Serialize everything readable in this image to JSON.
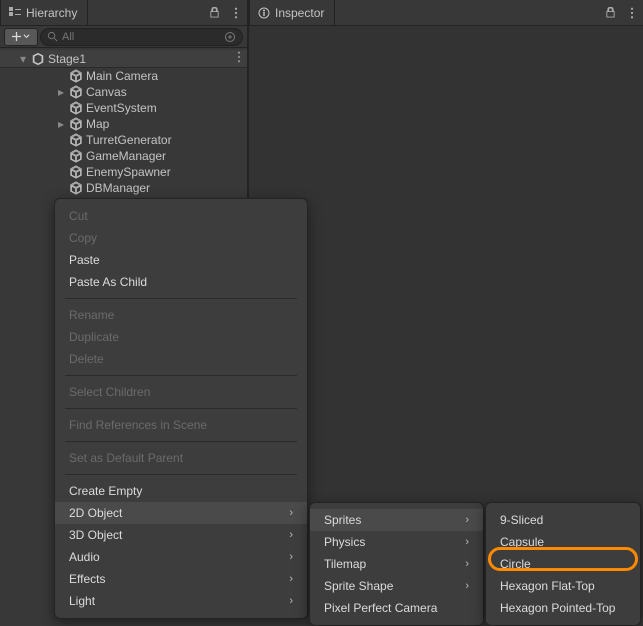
{
  "panels": {
    "hierarchy": {
      "title": "Hierarchy"
    },
    "inspector": {
      "title": "Inspector"
    }
  },
  "toolbar": {
    "search_placeholder": "All"
  },
  "scene": {
    "name": "Stage1",
    "items": [
      {
        "label": "Main Camera",
        "children": false
      },
      {
        "label": "Canvas",
        "children": true
      },
      {
        "label": "EventSystem",
        "children": false
      },
      {
        "label": "Map",
        "children": true
      },
      {
        "label": "TurretGenerator",
        "children": false
      },
      {
        "label": "GameManager",
        "children": false
      },
      {
        "label": "EnemySpawner",
        "children": false
      },
      {
        "label": "DBManager",
        "children": false
      }
    ]
  },
  "context_menu": {
    "cut": "Cut",
    "copy": "Copy",
    "paste": "Paste",
    "paste_child": "Paste As Child",
    "rename": "Rename",
    "duplicate": "Duplicate",
    "delete": "Delete",
    "select_children": "Select Children",
    "find_refs": "Find References in Scene",
    "set_default_parent": "Set as Default Parent",
    "create_empty": "Create Empty",
    "two_d_object": "2D Object",
    "three_d_object": "3D Object",
    "audio": "Audio",
    "effects": "Effects",
    "light": "Light"
  },
  "submenu_2d": {
    "sprites": "Sprites",
    "physics": "Physics",
    "tilemap": "Tilemap",
    "sprite_shape": "Sprite Shape",
    "pixel_perfect": "Pixel Perfect Camera"
  },
  "submenu_sprites": {
    "nine_sliced": "9-Sliced",
    "capsule": "Capsule",
    "circle": "Circle",
    "hex_flat": "Hexagon Flat-Top",
    "hex_point": "Hexagon Pointed-Top"
  }
}
